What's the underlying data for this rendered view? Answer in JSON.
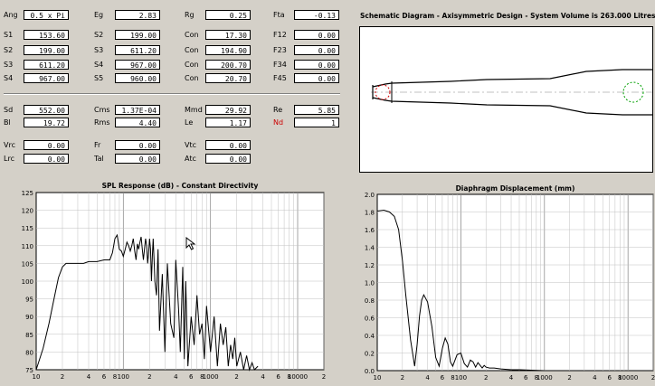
{
  "parameters": [
    {
      "label": "Ang",
      "value": "0.5 x Pi"
    },
    {
      "label": "Eg",
      "value": "2.83"
    },
    {
      "label": "Rg",
      "value": "0.25"
    },
    {
      "label": "Fta",
      "value": "-0.13"
    },
    {
      "label": "S1",
      "value": "153.60"
    },
    {
      "label": "S2",
      "value": "199.00"
    },
    {
      "label": "Con",
      "value": "17.30"
    },
    {
      "label": "F12",
      "value": "0.00"
    },
    {
      "label": "S2",
      "value": "199.00"
    },
    {
      "label": "S3",
      "value": "611.20"
    },
    {
      "label": "Con",
      "value": "194.90"
    },
    {
      "label": "F23",
      "value": "0.00"
    },
    {
      "label": "S3",
      "value": "611.20"
    },
    {
      "label": "S4",
      "value": "967.00"
    },
    {
      "label": "Con",
      "value": "200.70"
    },
    {
      "label": "F34",
      "value": "0.00"
    },
    {
      "label": "S4",
      "value": "967.00"
    },
    {
      "label": "S5",
      "value": "960.00"
    },
    {
      "label": "Con",
      "value": "20.70"
    },
    {
      "label": "F45",
      "value": "0.00"
    },
    {
      "label": "Sd",
      "value": "552.00"
    },
    {
      "label": "Cms",
      "value": "1.37E-04"
    },
    {
      "label": "Mmd",
      "value": "29.92"
    },
    {
      "label": "Re",
      "value": "5.85"
    },
    {
      "label": "Bl",
      "value": "19.72"
    },
    {
      "label": "Rms",
      "value": "4.40"
    },
    {
      "label": "Le",
      "value": "1.17"
    },
    {
      "label": "Nd",
      "value": "1"
    },
    {
      "label": "Vrc",
      "value": "0.00"
    },
    {
      "label": "Fr",
      "value": "0.00"
    },
    {
      "label": "Vtc",
      "value": "0.00"
    },
    {
      "label": "Lrc",
      "value": "0.00"
    },
    {
      "label": "Tal",
      "value": "0.00"
    },
    {
      "label": "Atc",
      "value": "0.00"
    }
  ],
  "colors": {
    "background": "#d4d0c8",
    "highlight_label": "#cc0000",
    "plot_line": "#000000",
    "grid": "#c0c0c0"
  },
  "schematic": {
    "title": "Schematic Diagram - Axisymmetric Design - System Volume is 263.000 Litres"
  },
  "chart_data": [
    {
      "type": "line",
      "title": "SPL Response (dB) - Constant Directivity",
      "x_scale": "log",
      "xlim": [
        10,
        20000
      ],
      "ylim": [
        75,
        125
      ],
      "xticks": [
        "10",
        "2",
        "4",
        "6",
        "8",
        "100",
        "2",
        "4",
        "6",
        "8",
        "1000",
        "2",
        "4",
        "6",
        "8",
        "10000",
        "2"
      ],
      "yticks": [
        "75",
        "80",
        "85",
        "90",
        "95",
        "100",
        "105",
        "110",
        "115",
        "120",
        "125"
      ],
      "grid": true,
      "series": [
        {
          "x": [
            10,
            12,
            14,
            16,
            18,
            20,
            22,
            25,
            28,
            30,
            35,
            40,
            50,
            60,
            70,
            75,
            80,
            85,
            90,
            95,
            100,
            105,
            110,
            115,
            120,
            125,
            130,
            135,
            140,
            145,
            150,
            155,
            160,
            165,
            170,
            175,
            180,
            185,
            190,
            195,
            200,
            205,
            210,
            215,
            220,
            225,
            230,
            240,
            250,
            260,
            280,
            300,
            320,
            350,
            380,
            400,
            430,
            450,
            480,
            500,
            520,
            550,
            600,
            650,
            700,
            750,
            800,
            850,
            900,
            1000,
            1100,
            1200,
            1300,
            1400,
            1500,
            1600,
            1700,
            1800,
            1900,
            2000,
            2200,
            2400,
            2600,
            2800,
            3000,
            3200,
            3500
          ],
          "y": [
            75,
            81,
            88,
            95,
            101,
            104,
            105,
            105,
            105,
            105,
            105,
            105.5,
            105.5,
            106,
            106,
            108,
            112,
            113,
            109,
            108.5,
            107,
            109,
            111,
            110,
            108.5,
            110,
            112,
            108.5,
            106,
            110.5,
            109,
            111,
            112.5,
            109,
            106,
            109,
            112,
            110,
            105,
            108,
            112,
            109,
            100,
            107,
            112,
            106,
            100,
            96,
            109,
            86,
            102,
            80,
            105,
            88,
            84,
            106,
            92,
            80,
            104,
            78,
            100,
            76,
            90,
            82,
            96,
            85,
            88,
            78,
            93,
            80,
            90,
            76,
            88,
            82,
            87,
            76,
            82,
            78,
            84,
            76,
            80,
            75,
            79,
            75,
            77,
            75,
            76
          ]
        }
      ]
    },
    {
      "type": "line",
      "title": "Diaphragm Displacement (mm)",
      "x_scale": "log",
      "xlim": [
        10,
        20000
      ],
      "ylim": [
        0,
        2
      ],
      "xticks": [
        "10",
        "2",
        "4",
        "6",
        "8",
        "100",
        "2",
        "4",
        "6",
        "8",
        "1000",
        "2",
        "4",
        "6",
        "8",
        "10000",
        "2"
      ],
      "yticks": [
        "0.0",
        "0.2",
        "0.4",
        "0.6",
        "0.8",
        "1.0",
        "1.2",
        "1.4",
        "1.6",
        "1.8",
        "2.0"
      ],
      "grid": true,
      "series": [
        {
          "x": [
            10,
            12,
            14,
            16,
            18,
            20,
            22,
            25,
            28,
            30,
            32,
            34,
            36,
            40,
            45,
            50,
            55,
            60,
            65,
            70,
            75,
            80,
            90,
            100,
            110,
            120,
            130,
            140,
            150,
            160,
            170,
            180,
            190,
            200,
            220,
            250,
            300,
            400,
            500,
            700,
            1000
          ],
          "y": [
            1.81,
            1.82,
            1.8,
            1.75,
            1.6,
            1.25,
            0.85,
            0.35,
            0.05,
            0.3,
            0.62,
            0.8,
            0.86,
            0.78,
            0.5,
            0.15,
            0.05,
            0.25,
            0.37,
            0.3,
            0.1,
            0.05,
            0.18,
            0.2,
            0.08,
            0.04,
            0.12,
            0.1,
            0.04,
            0.09,
            0.06,
            0.03,
            0.06,
            0.04,
            0.03,
            0.03,
            0.02,
            0.01,
            0.01,
            0.005,
            0
          ]
        }
      ]
    }
  ]
}
